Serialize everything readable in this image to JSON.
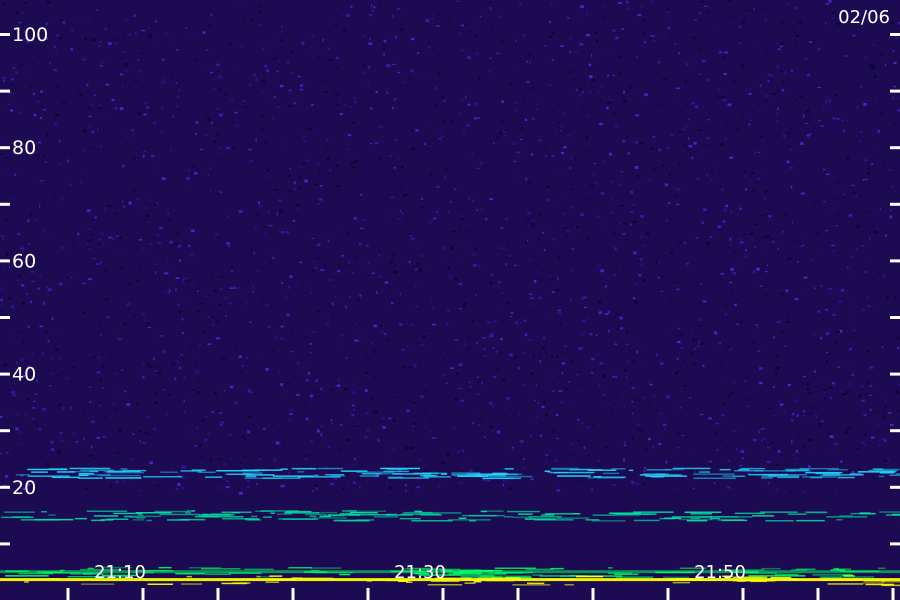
{
  "date_label": "02/06",
  "chart_data": {
    "type": "heatmap",
    "title": "",
    "xlabel": "",
    "ylabel": "",
    "ylim": [
      0,
      106
    ],
    "xlim": [
      "21:02",
      "22:02"
    ],
    "y_ticks_labeled": [
      "100",
      "80",
      "60",
      "40",
      "20"
    ],
    "y_tick_values": [
      100,
      80,
      60,
      40,
      20
    ],
    "y_minor_tick_values": [
      90,
      70,
      50,
      30,
      10
    ],
    "x_ticks_labeled": [
      "21:10",
      "21:30",
      "21:50"
    ],
    "x_tick_values_minutes": [
      21.5,
      26.5,
      31.5,
      36.5,
      41.5,
      46.5,
      51.5,
      56.5,
      61.5,
      66.5,
      71.5,
      76.5
    ],
    "background_level": "low noise (dark violet)",
    "bands": [
      {
        "name": "",
        "y": 22.5,
        "intensity": "moderate",
        "color": "#1fd8ff"
      },
      {
        "name": "",
        "y": 15,
        "intensity": "moderate",
        "color": "#00e0a0"
      },
      {
        "name": "",
        "y": 5,
        "intensity": "high",
        "color": "#00ff60"
      },
      {
        "name": "",
        "y": 3.6,
        "intensity": "very high",
        "color": "#fcff00"
      }
    ],
    "colors": {
      "background": "#1c0a52",
      "noise_dark": "#0c0330",
      "noise_light": "#3a18a8",
      "axis": "#ffffff"
    }
  }
}
